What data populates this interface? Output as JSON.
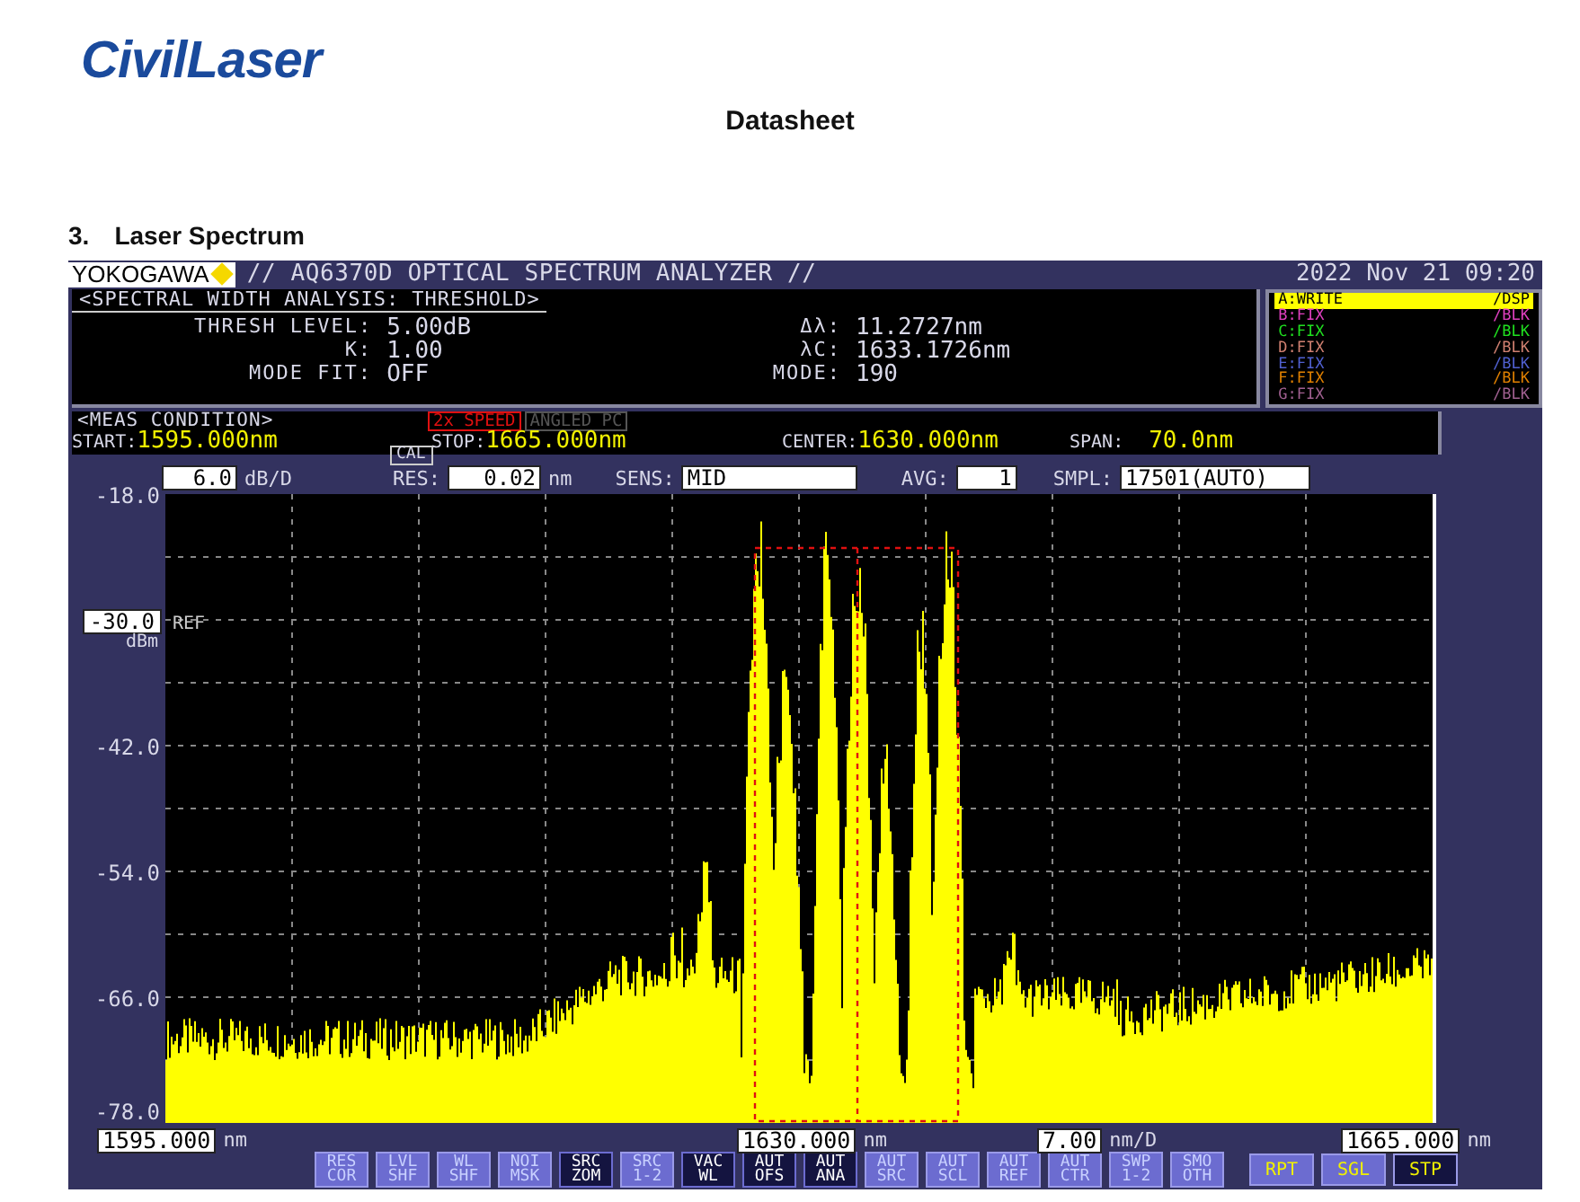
{
  "document": {
    "logo": "CivilLaser",
    "title": "Datasheet",
    "section_number": "3.",
    "section_title": "Laser Spectrum"
  },
  "instrument": {
    "brand": "YOKOGAWA",
    "title": "// AQ6370D OPTICAL SPECTRUM ANALYZER //",
    "datetime": "2022 Nov 21 09:20",
    "analysis": {
      "heading": "<SPECTRAL WIDTH ANALYSIS: THRESHOLD>",
      "left": [
        {
          "label": "THRESH LEVEL:",
          "value": "5.00dB"
        },
        {
          "label": "K:",
          "value": "1.00"
        },
        {
          "label": "MODE FIT:",
          "value": "OFF"
        }
      ],
      "right": [
        {
          "label": "Δλ:",
          "value": "11.2727nm"
        },
        {
          "label": "λC:",
          "value": "1633.1726nm"
        },
        {
          "label": "MODE:",
          "value": "190"
        }
      ]
    },
    "traces": [
      {
        "name": "A:WRITE",
        "status": "/DSP",
        "color": "#ffff00",
        "selected": true
      },
      {
        "name": "B:FIX",
        "status": "/BLK",
        "color": "#e040c0",
        "selected": false
      },
      {
        "name": "C:FIX",
        "status": "/BLK",
        "color": "#20e020",
        "selected": false
      },
      {
        "name": "D:FIX",
        "status": "/BLK",
        "color": "#d08070",
        "selected": false
      },
      {
        "name": "E:FIX",
        "status": "/BLK",
        "color": "#5060d0",
        "selected": false
      },
      {
        "name": "F:FIX",
        "status": "/BLK",
        "color": "#e08000",
        "selected": false
      },
      {
        "name": "G:FIX",
        "status": "/BLK",
        "color": "#a06090",
        "selected": false
      }
    ],
    "meas": {
      "heading": "<MEAS CONDITION>",
      "flags": [
        {
          "label": "2x SPEED",
          "on": true
        },
        {
          "label": "ANGLED PC",
          "on": false
        }
      ],
      "fields": [
        {
          "label": "START:",
          "value": "1595.000nm"
        },
        {
          "label": "STOP:",
          "value": "1665.000nm"
        },
        {
          "label": "CENTER:",
          "value": "1630.000nm"
        },
        {
          "label": "SPAN:",
          "value": "70.0nm"
        }
      ]
    },
    "scale": {
      "db_per_div": "6.0",
      "db_unit": "dB/D",
      "cal": "CAL",
      "res_label": "RES:",
      "res": "0.02",
      "res_unit": "nm",
      "sens_label": "SENS:",
      "sens": "MID",
      "avg_label": "AVG:",
      "avg": "1",
      "smpl_label": "SMPL:",
      "smpl": "17501(AUTO)"
    },
    "y_labels": [
      "-18.0",
      "-30.0",
      "-42.0",
      "-54.0",
      "-66.0",
      "-78.0"
    ],
    "ref": {
      "label": "REF",
      "unit": "dBm"
    },
    "x_labels": [
      {
        "value": "1595.000",
        "unit": "nm"
      },
      {
        "value": "1630.000",
        "unit": "nm"
      },
      {
        "value": "7.00",
        "unit": "nm/D"
      },
      {
        "value": "1665.000",
        "unit": "nm"
      }
    ],
    "soft_keys": [
      {
        "lines": [
          "RES",
          "COR"
        ],
        "active": false
      },
      {
        "lines": [
          "LVL",
          "SHF"
        ],
        "active": false
      },
      {
        "lines": [
          "WL",
          "SHF"
        ],
        "active": false
      },
      {
        "lines": [
          "NOI",
          "MSK"
        ],
        "active": false
      },
      {
        "lines": [
          "SRC",
          "ZOM"
        ],
        "active": true
      },
      {
        "lines": [
          "SRC",
          "1-2"
        ],
        "active": false
      },
      {
        "lines": [
          "VAC",
          "WL"
        ],
        "active": true
      },
      {
        "lines": [
          "AUT",
          "OFS"
        ],
        "active": true
      },
      {
        "lines": [
          "AUT",
          "ANA"
        ],
        "active": true
      },
      {
        "lines": [
          "AUT",
          "SRC"
        ],
        "active": false
      },
      {
        "lines": [
          "AUT",
          "SCL"
        ],
        "active": false
      },
      {
        "lines": [
          "AUT",
          "REF"
        ],
        "active": false
      },
      {
        "lines": [
          "AUT",
          "CTR"
        ],
        "active": false
      },
      {
        "lines": [
          "SWP",
          "1-2"
        ],
        "active": false
      },
      {
        "lines": [
          "SMO",
          "OTH"
        ],
        "active": false
      }
    ],
    "run_keys": [
      {
        "label": "RPT",
        "active": false
      },
      {
        "label": "SGL",
        "active": false
      },
      {
        "label": "STP",
        "active": true
      }
    ]
  }
}
